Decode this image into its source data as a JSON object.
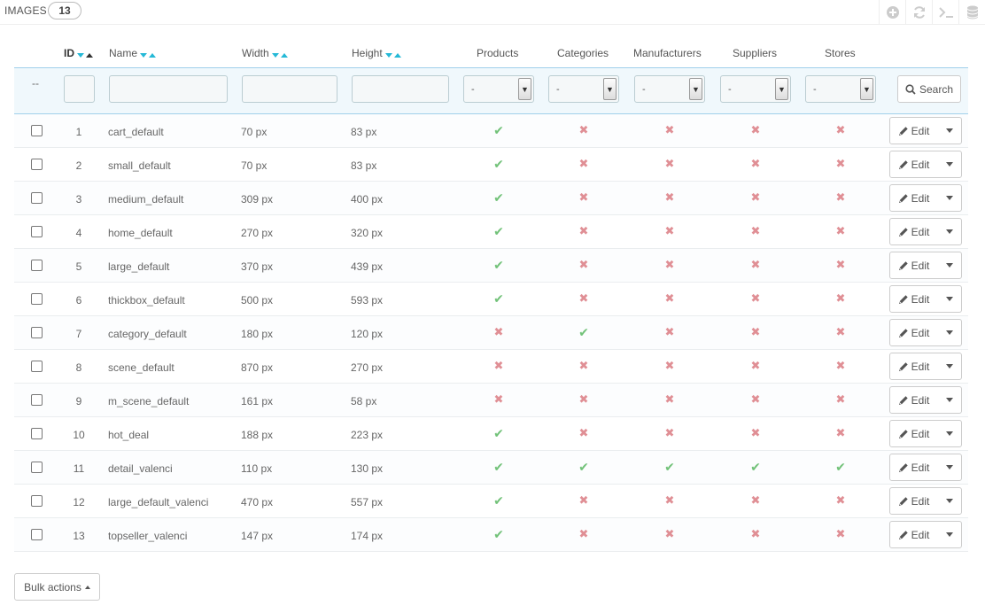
{
  "header": {
    "title": "IMAGES",
    "count": "13",
    "tools": [
      "add-icon",
      "refresh-icon",
      "terminal-icon",
      "database-icon"
    ]
  },
  "columns": {
    "id": "ID",
    "name": "Name",
    "width": "Width",
    "height": "Height",
    "products": "Products",
    "categories": "Categories",
    "manufacturers": "Manufacturers",
    "suppliers": "Suppliers",
    "stores": "Stores"
  },
  "filters": {
    "dash": "--",
    "select_default": "-",
    "search_label": "Search"
  },
  "rows": [
    {
      "id": "1",
      "name": "cart_default",
      "width": "70 px",
      "height": "83 px",
      "products": true,
      "categories": false,
      "manufacturers": false,
      "suppliers": false,
      "stores": false
    },
    {
      "id": "2",
      "name": "small_default",
      "width": "70 px",
      "height": "83 px",
      "products": true,
      "categories": false,
      "manufacturers": false,
      "suppliers": false,
      "stores": false
    },
    {
      "id": "3",
      "name": "medium_default",
      "width": "309 px",
      "height": "400 px",
      "products": true,
      "categories": false,
      "manufacturers": false,
      "suppliers": false,
      "stores": false
    },
    {
      "id": "4",
      "name": "home_default",
      "width": "270 px",
      "height": "320 px",
      "products": true,
      "categories": false,
      "manufacturers": false,
      "suppliers": false,
      "stores": false
    },
    {
      "id": "5",
      "name": "large_default",
      "width": "370 px",
      "height": "439 px",
      "products": true,
      "categories": false,
      "manufacturers": false,
      "suppliers": false,
      "stores": false
    },
    {
      "id": "6",
      "name": "thickbox_default",
      "width": "500 px",
      "height": "593 px",
      "products": true,
      "categories": false,
      "manufacturers": false,
      "suppliers": false,
      "stores": false
    },
    {
      "id": "7",
      "name": "category_default",
      "width": "180 px",
      "height": "120 px",
      "products": false,
      "categories": true,
      "manufacturers": false,
      "suppliers": false,
      "stores": false
    },
    {
      "id": "8",
      "name": "scene_default",
      "width": "870 px",
      "height": "270 px",
      "products": false,
      "categories": false,
      "manufacturers": false,
      "suppliers": false,
      "stores": false
    },
    {
      "id": "9",
      "name": "m_scene_default",
      "width": "161 px",
      "height": "58 px",
      "products": false,
      "categories": false,
      "manufacturers": false,
      "suppliers": false,
      "stores": false
    },
    {
      "id": "10",
      "name": "hot_deal",
      "width": "188 px",
      "height": "223 px",
      "products": true,
      "categories": false,
      "manufacturers": false,
      "suppliers": false,
      "stores": false
    },
    {
      "id": "11",
      "name": "detail_valenci",
      "width": "110 px",
      "height": "130 px",
      "products": true,
      "categories": true,
      "manufacturers": true,
      "suppliers": true,
      "stores": true
    },
    {
      "id": "12",
      "name": "large_default_valenci",
      "width": "470 px",
      "height": "557 px",
      "products": true,
      "categories": false,
      "manufacturers": false,
      "suppliers": false,
      "stores": false
    },
    {
      "id": "13",
      "name": "topseller_valenci",
      "width": "147 px",
      "height": "174 px",
      "products": true,
      "categories": false,
      "manufacturers": false,
      "suppliers": false,
      "stores": false
    }
  ],
  "row_actions": {
    "edit_label": "Edit"
  },
  "footer": {
    "bulk_label": "Bulk actions"
  },
  "colors": {
    "yes": "#72c279",
    "no": "#e08f95",
    "accent": "#25b9d7"
  }
}
